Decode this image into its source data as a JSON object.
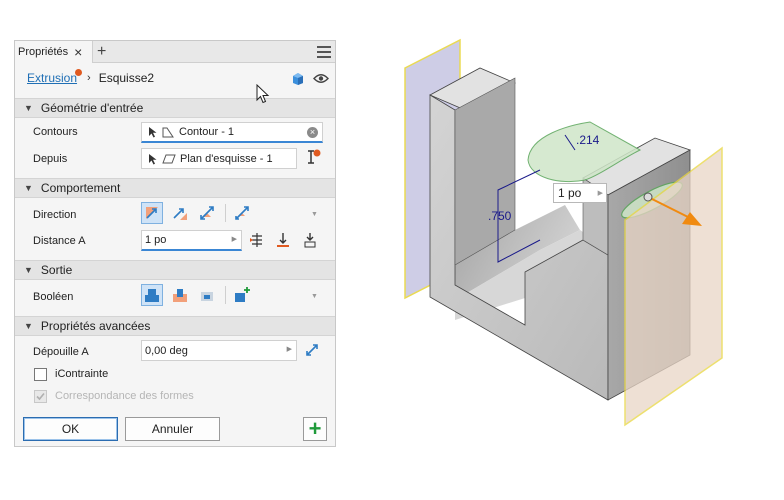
{
  "panel": {
    "tab_label": "Propriétés",
    "tab_close": "×",
    "tab_add": "+",
    "breadcrumb": {
      "feature": "Extrusion",
      "separator": "›",
      "sketch": "Esquisse2"
    },
    "sections": {
      "input_geometry": "Géométrie d'entrée",
      "behavior": "Comportement",
      "output": "Sortie",
      "advanced": "Propriétés avancées"
    },
    "rows": {
      "profiles_label": "Contours",
      "profiles_value": "Contour - 1",
      "from_label": "Depuis",
      "from_value": "Plan d'esquisse - 1",
      "direction_label": "Direction",
      "distance_label": "Distance A",
      "distance_value": "1 po",
      "boolean_label": "Booléen",
      "taper_label": "Dépouille A",
      "taper_value": "0,00 deg",
      "iconstraint_label": "iContrainte",
      "match_shape_label": "Correspondance des formes"
    },
    "buttons": {
      "ok": "OK",
      "cancel": "Annuler",
      "add": "+"
    },
    "checkbox_iconstraint_checked": false,
    "checkbox_match_shape_checked": true,
    "checkbox_match_shape_enabled": false,
    "direction_selected": "default",
    "boolean_selected": "join"
  },
  "viewport": {
    "dimension_height": ".750",
    "dimension_radius": ".214",
    "distance_box": "1 po"
  },
  "colors": {
    "accent": "#3a86d4",
    "link": "#1f6fb5",
    "error_dot": "#e05a20",
    "add_green": "#1f9a3a",
    "sketch_plane_left": "#c9c8e4",
    "sketch_plane_right": "#e9d6c6",
    "preview_green": "#cfe6c8",
    "arrow_orange": "#f08a10",
    "dimension_blue": "#1a1a8a"
  },
  "icons": {
    "close": "close-icon",
    "add_tab": "plus-icon",
    "menu": "hamburger-menu-icon",
    "cube": "3d-cube-icon",
    "visibility": "eye-icon",
    "select_pointer": "pointer-icon",
    "profile": "profile-shape-icon",
    "plane": "plane-icon",
    "clear": "clear-x-icon"
  }
}
